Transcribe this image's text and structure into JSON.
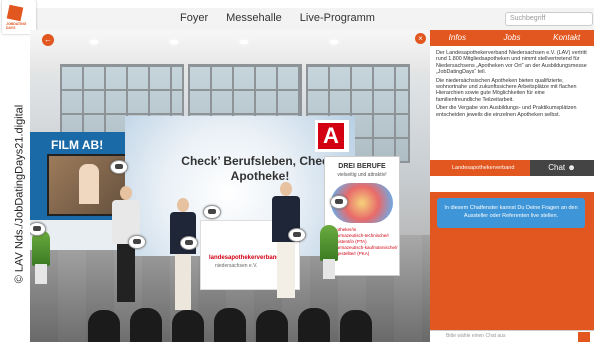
{
  "brand": {
    "logo_text": "JOBDATING DAYS"
  },
  "nav": {
    "items": [
      "Foyer",
      "Messehalle",
      "Live-Programm"
    ]
  },
  "search": {
    "placeholder": "Suchbegriff"
  },
  "scene": {
    "film_title": "FILM AB!",
    "slogan": "Check’ Berufsleben, Check’ Apotheke!",
    "counter_label": "landesapothekerverband",
    "counter_sub": "niedersachsen e.V.",
    "berufe_title": "DREI BERUFE",
    "berufe_subtitle": "vielseitig und attraktiv!",
    "berufe_list": [
      "Apotheker/in",
      "Pharmazeutisch-technische/r Assistent/in (PTA)",
      "Pharmazeutisch-kaufmännische/r Angestellte/r (PKA)"
    ]
  },
  "panel": {
    "tabs": [
      "Infos",
      "Jobs",
      "Kontakt"
    ],
    "info_paragraphs": [
      "Der Landesapothekerverband Niedersachsen e.V. (LAV) vertritt rund 1.800 Mitgliedsapotheken und nimmt stellvertretend für Niedersachsens „Apotheken vor Ort“ an der Ausbildungsmesse „JobDatingDays“ teil.",
      "Die niedersächsischen Apotheken bieten qualifizierte, wohnortnahe und zukunftssichere Arbeitsplätze mit flachen Hierarchien sowie gute Möglichkeiten für eine familienfreundliche Teilzeitarbeit.",
      "Über die Vergabe von Ausbildungs- und Praktikumsplätzen entscheiden jeweils die einzelnen Apotheken selbst."
    ],
    "chat_tab_left": "Landesapothekerverband",
    "chat_tab_right": "Chat",
    "chat_message": "In diesem Chatfenster kannst Du Deine Fragen an den Aussteller oder Referenten live stellen.",
    "input_placeholder": "Bitte wähle einen Chat aus"
  },
  "copyright": "© LAV Nds./JobDatingDays21.digital",
  "colors": {
    "accent": "#e2561f",
    "blue": "#3e96d8"
  }
}
